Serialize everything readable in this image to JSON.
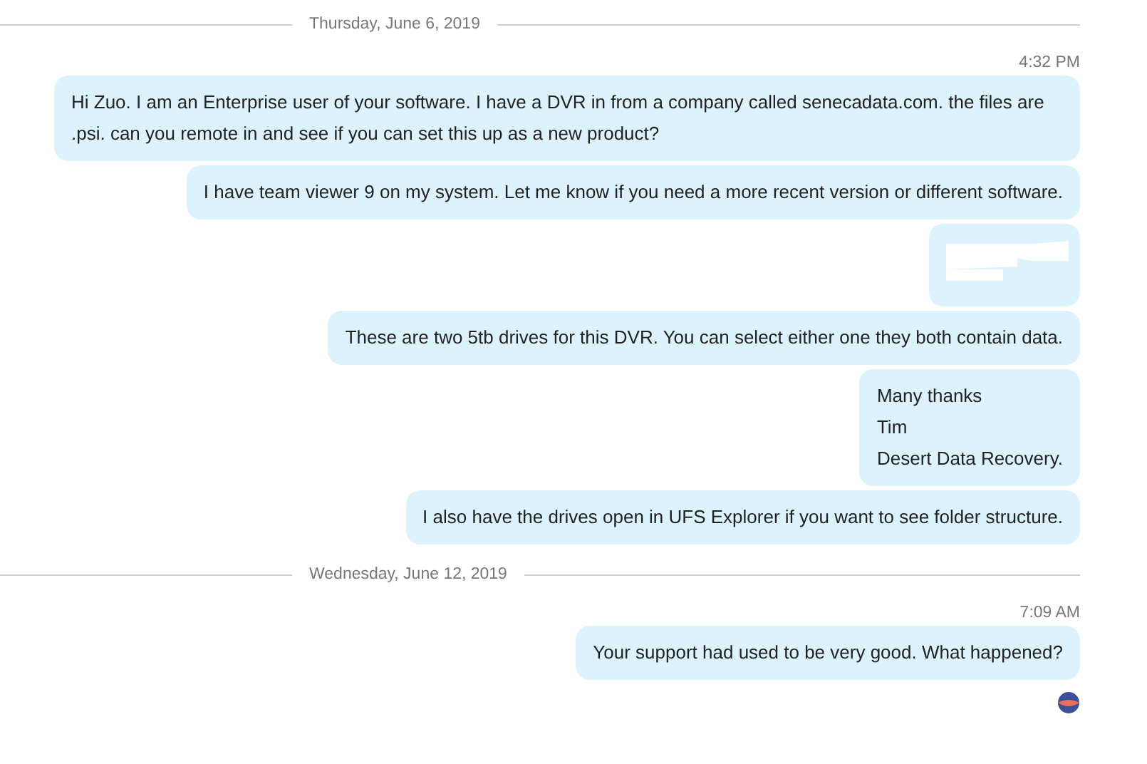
{
  "days": [
    {
      "date": "Thursday, June 6, 2019",
      "time": "4:32 PM",
      "messages": [
        {
          "kind": "text",
          "lines": [
            "Hi Zuo. I am an Enterprise user of your software. I have a DVR in from a company called senecadata.com. the files are .psi. can you remote in and see if you can set this up as a new product?"
          ]
        },
        {
          "kind": "text",
          "lines": [
            "I have team viewer 9 on my system. Let me know if you need a more recent version or different software."
          ]
        },
        {
          "kind": "redacted"
        },
        {
          "kind": "text",
          "lines": [
            "These are two 5tb drives for this DVR. You can select either one they both contain data."
          ]
        },
        {
          "kind": "text",
          "lines": [
            "Many thanks",
            "Tim",
            "Desert Data Recovery."
          ]
        },
        {
          "kind": "text",
          "lines": [
            "I also have the drives open in UFS Explorer if you want to see folder structure."
          ]
        }
      ]
    },
    {
      "date": "Wednesday, June 12, 2019",
      "time": "7:09 AM",
      "messages": [
        {
          "kind": "text",
          "lines": [
            "Your support had used to be very good. What happened?"
          ]
        }
      ]
    }
  ],
  "read_receipt": {
    "kind": "avatar"
  }
}
